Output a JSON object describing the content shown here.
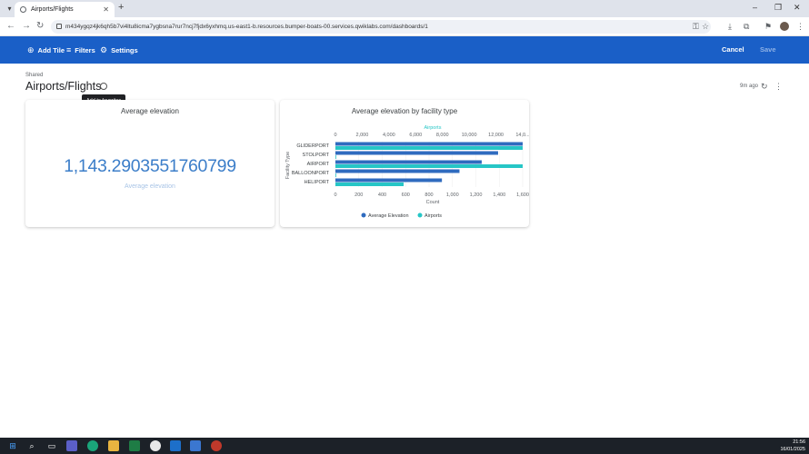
{
  "browser": {
    "tab_title": "Airports/Flights",
    "url": "m434ygqz4jk6qh5b7vi4ltu8icma7ygbsna7rur7ncj7fjdx6yxhmq.us-east1-b.resources.bumper-boats-00.services.qwiklabs.com/dashboards/1"
  },
  "toolbar": {
    "add_tile_label": "Add Tile",
    "filters_label": "Filters",
    "settings_label": "Settings",
    "cancel_label": "Cancel",
    "save_label": "Save"
  },
  "dashboard": {
    "folder_label": "Shared",
    "title": "Airports/Flights",
    "favorite_tooltip": "Add to favorites",
    "updated_ago": "9m ago"
  },
  "tile1": {
    "title": "Average elevation",
    "value": "1,143.2903551760799",
    "subtitle": "Average elevation"
  },
  "tile2": {
    "title": "Average elevation by facility type"
  },
  "chart_data": {
    "type": "bar",
    "orientation": "horizontal",
    "title": "Average elevation by facility type",
    "categories": [
      "GLIDERPORT",
      "STOLPORT",
      "AIRPORT",
      "BALLOONPORT",
      "HELIPORT"
    ],
    "ylabel": "Facility Type",
    "series": [
      {
        "name": "Average Elevation",
        "axis": "bottom",
        "color": "#2f6bbf",
        "values": [
          1600,
          1390,
          1250,
          1060,
          910
        ]
      },
      {
        "name": "Airports",
        "axis": "top",
        "color": "#26c6c6",
        "values": [
          14000,
          30,
          14000,
          40,
          5100
        ]
      }
    ],
    "bottom_axis": {
      "label": "Count",
      "ticks": [
        "0",
        "200",
        "400",
        "600",
        "800",
        "1,000",
        "1,200",
        "1,400",
        "1,600"
      ],
      "range": [
        0,
        1600
      ]
    },
    "top_axis": {
      "label": "Airports",
      "ticks": [
        "0",
        "2,000",
        "4,000",
        "6,000",
        "8,000",
        "10,000",
        "12,000",
        "14,0..."
      ],
      "range": [
        0,
        14000
      ]
    },
    "legend_position": "bottom",
    "grid": true
  },
  "taskbar": {
    "time": "21:56",
    "date": "16/01/2025"
  },
  "colors": {
    "header_blue": "#1a5fc7",
    "value_blue": "#3c7ec9",
    "series_dark": "#2f6bbf",
    "series_teal": "#26c6c6"
  }
}
